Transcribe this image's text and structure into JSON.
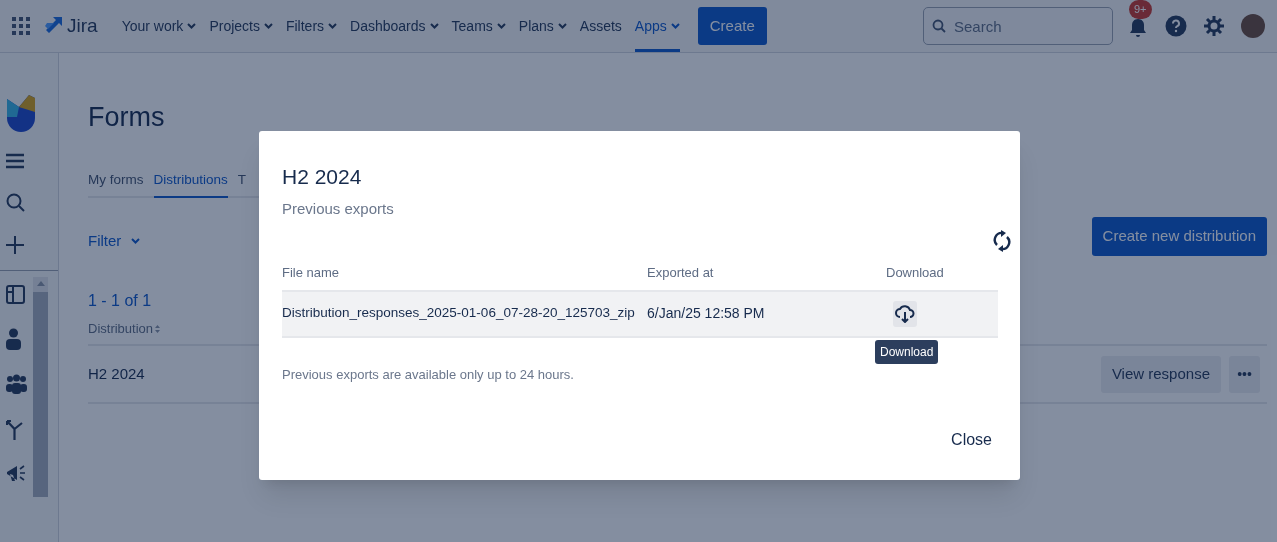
{
  "topnav": {
    "product": "Jira",
    "items": [
      {
        "label": "Your work",
        "dropdown": true,
        "selected": false
      },
      {
        "label": "Projects",
        "dropdown": true,
        "selected": false
      },
      {
        "label": "Filters",
        "dropdown": true,
        "selected": false
      },
      {
        "label": "Dashboards",
        "dropdown": true,
        "selected": false
      },
      {
        "label": "Teams",
        "dropdown": true,
        "selected": false
      },
      {
        "label": "Plans",
        "dropdown": true,
        "selected": false
      },
      {
        "label": "Assets",
        "dropdown": false,
        "selected": false
      },
      {
        "label": "Apps",
        "dropdown": true,
        "selected": true
      }
    ],
    "create_button": "Create",
    "search": {
      "placeholder": "Search"
    },
    "notification_count": "9+"
  },
  "page": {
    "title": "Forms",
    "tabs": [
      {
        "label": "My forms",
        "selected": false
      },
      {
        "label": "Distributions",
        "selected": true
      },
      {
        "label": "T",
        "selected": false
      }
    ],
    "filter": "Filter",
    "create_button": "Create new distribution",
    "count": "1 - 1 of 1",
    "table": {
      "columns": [
        "Distribution"
      ],
      "rows": [
        {
          "name": "H2 2024",
          "action": "View response",
          "more": "•••"
        }
      ]
    }
  },
  "modal": {
    "title": "H2 2024",
    "subtitle": "Previous exports",
    "table": {
      "columns": [
        "File name",
        "Exported at",
        "Download"
      ],
      "rows": [
        {
          "file_name": "Distribution_responses_2025-01-06_07-28-20_125703_zip",
          "exported_at": "6/Jan/25 12:58 PM",
          "hovered": true
        }
      ]
    },
    "tooltip": "Download",
    "note": "Previous exports are available only up to 24 hours.",
    "close_button": "Close"
  }
}
